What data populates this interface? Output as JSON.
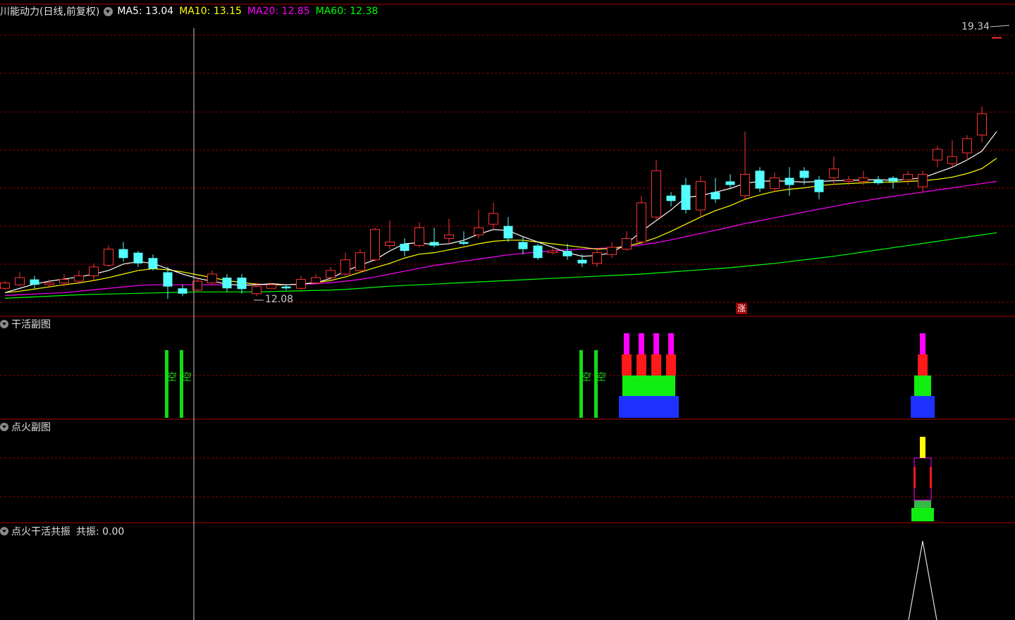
{
  "header": {
    "stock_name": "川能动力(日线,前复权)",
    "ma_labels": [
      {
        "text": "MA5: 13.04",
        "color": "#ffffff"
      },
      {
        "text": "MA10: 13.15",
        "color": "#ffff00"
      },
      {
        "text": "MA20: 12.85",
        "color": "#ff00ff"
      },
      {
        "text": "MA60: 12.38",
        "color": "#00ff00"
      }
    ]
  },
  "annotations": {
    "high_label": "19.34",
    "low_label": "12.08",
    "zhang_badge": "涨"
  },
  "panels": [
    {
      "title": "干活副图"
    },
    {
      "title": "点火副图"
    },
    {
      "title": "点火干活共振",
      "value_text": "共振: 0.00"
    }
  ],
  "colors": {
    "up": "#ff3232",
    "down": "#54ffff",
    "ma5": "#ffffff",
    "ma10": "#ffff00",
    "ma20": "#ff00ff",
    "ma60": "#00ff00",
    "grid": "#8b0000",
    "border": "#b00000"
  },
  "chart_data": [
    {
      "type": "candlestick",
      "x": [
        0,
        1,
        2,
        3,
        4,
        5,
        6,
        7,
        8,
        9,
        10,
        11,
        12,
        13,
        14,
        15,
        16,
        17,
        18,
        19,
        20,
        21,
        22,
        23,
        24,
        25,
        26,
        27,
        28,
        29,
        30,
        31,
        32,
        33,
        34,
        35,
        36,
        37,
        38,
        39,
        40,
        41,
        42,
        43,
        44,
        45,
        46,
        47,
        48,
        49,
        50,
        51,
        52,
        53,
        54,
        55,
        56,
        57,
        58,
        59,
        60,
        61,
        62,
        63,
        64,
        65,
        66,
        67
      ],
      "open": [
        12.3,
        12.4,
        12.55,
        12.4,
        12.45,
        12.5,
        12.65,
        12.95,
        13.4,
        13.3,
        13.15,
        12.75,
        12.3,
        12.25,
        12.45,
        12.6,
        12.6,
        12.15,
        12.3,
        12.35,
        12.3,
        12.45,
        12.6,
        12.7,
        12.8,
        13.1,
        13.5,
        13.55,
        13.5,
        13.6,
        13.7,
        13.6,
        13.8,
        14.1,
        14.05,
        13.6,
        13.5,
        13.3,
        13.35,
        13.1,
        13.0,
        13.25,
        13.4,
        13.6,
        14.3,
        14.9,
        15.2,
        14.5,
        15.0,
        15.3,
        14.9,
        15.6,
        15.1,
        15.4,
        15.6,
        15.35,
        15.4,
        15.3,
        15.3,
        15.35,
        15.4,
        15.35,
        15.15,
        15.9,
        15.8,
        16.1,
        16.6,
        19.34
      ],
      "close": [
        12.45,
        12.6,
        12.4,
        12.45,
        12.55,
        12.65,
        12.9,
        13.4,
        13.15,
        13.0,
        12.85,
        12.35,
        12.15,
        12.5,
        12.7,
        12.3,
        12.28,
        12.35,
        12.4,
        12.3,
        12.55,
        12.6,
        12.8,
        13.1,
        13.3,
        13.95,
        13.6,
        13.35,
        14.0,
        13.5,
        13.8,
        13.55,
        14.0,
        14.4,
        13.7,
        13.4,
        13.15,
        13.35,
        13.2,
        13.0,
        13.3,
        13.45,
        13.7,
        14.7,
        15.6,
        14.75,
        14.5,
        15.3,
        14.8,
        15.2,
        15.5,
        15.1,
        15.4,
        15.2,
        15.4,
        15.0,
        15.65,
        15.35,
        15.4,
        15.25,
        15.3,
        15.5,
        15.5,
        16.2,
        16.0,
        16.5,
        17.2,
        19.34
      ],
      "high": [
        12.5,
        12.75,
        12.65,
        12.55,
        12.7,
        12.8,
        13.0,
        13.5,
        13.6,
        13.35,
        13.25,
        12.9,
        12.4,
        12.6,
        12.8,
        12.7,
        12.7,
        12.45,
        12.45,
        12.4,
        12.65,
        12.7,
        12.9,
        13.3,
        13.4,
        14.0,
        14.2,
        13.7,
        14.15,
        14.0,
        14.25,
        13.9,
        14.5,
        14.7,
        14.3,
        13.75,
        13.55,
        13.45,
        13.55,
        13.25,
        13.4,
        13.6,
        13.9,
        14.9,
        15.9,
        15.0,
        15.4,
        15.45,
        15.4,
        15.5,
        16.7,
        15.7,
        15.55,
        15.7,
        15.7,
        15.45,
        16.0,
        15.45,
        15.6,
        15.45,
        15.45,
        15.6,
        15.6,
        16.3,
        16.45,
        16.6,
        17.4,
        19.34
      ],
      "low": [
        12.25,
        12.35,
        12.3,
        12.35,
        12.35,
        12.45,
        12.5,
        12.9,
        13.05,
        12.9,
        12.8,
        12.0,
        12.08,
        12.2,
        12.4,
        12.2,
        12.15,
        12.08,
        12.3,
        12.25,
        12.25,
        12.4,
        12.55,
        12.65,
        12.75,
        13.05,
        13.4,
        13.2,
        13.45,
        13.45,
        13.55,
        13.5,
        13.7,
        13.95,
        13.6,
        13.25,
        13.1,
        13.25,
        13.1,
        12.9,
        12.9,
        13.15,
        13.35,
        13.55,
        14.2,
        14.6,
        14.4,
        14.3,
        14.7,
        15.1,
        14.8,
        15.0,
        15.0,
        14.9,
        15.2,
        14.8,
        15.2,
        15.2,
        15.2,
        15.2,
        15.1,
        15.2,
        15.0,
        15.7,
        15.7,
        15.9,
        16.4,
        19.34
      ],
      "ma5": [
        12.18,
        12.3,
        12.42,
        12.5,
        12.56,
        12.62,
        12.7,
        12.8,
        12.98,
        13.05,
        13.0,
        12.85,
        12.7,
        12.58,
        12.5,
        12.42,
        12.38,
        12.4,
        12.43,
        12.4,
        12.42,
        12.45,
        12.58,
        12.78,
        12.95,
        13.1,
        13.35,
        13.55,
        13.58,
        13.52,
        13.55,
        13.65,
        13.82,
        13.95,
        13.92,
        13.75,
        13.6,
        13.45,
        13.3,
        13.2,
        13.22,
        13.3,
        13.55,
        13.9,
        14.2,
        14.5,
        14.85,
        14.9,
        15.0,
        15.1,
        15.25,
        15.3,
        15.32,
        15.3,
        15.28,
        15.3,
        15.32,
        15.33,
        15.34,
        15.35,
        15.33,
        15.36,
        15.4,
        15.55,
        15.7,
        15.9,
        16.15,
        16.7
      ],
      "ma10": [
        12.18,
        12.22,
        12.28,
        12.34,
        12.4,
        12.45,
        12.52,
        12.6,
        12.7,
        12.8,
        12.85,
        12.82,
        12.76,
        12.68,
        12.6,
        12.52,
        12.46,
        12.42,
        12.4,
        12.4,
        12.42,
        12.46,
        12.52,
        12.62,
        12.75,
        12.88,
        13.0,
        13.15,
        13.26,
        13.3,
        13.38,
        13.46,
        13.55,
        13.62,
        13.65,
        13.65,
        13.6,
        13.55,
        13.5,
        13.45,
        13.4,
        13.42,
        13.48,
        13.58,
        13.72,
        13.9,
        14.1,
        14.3,
        14.48,
        14.62,
        14.8,
        14.92,
        15.02,
        15.08,
        15.12,
        15.18,
        15.22,
        15.24,
        15.26,
        15.28,
        15.28,
        15.3,
        15.32,
        15.36,
        15.42,
        15.52,
        15.66,
        15.95
      ],
      "ma20": [
        12.1,
        12.12,
        12.14,
        12.16,
        12.18,
        12.22,
        12.26,
        12.3,
        12.34,
        12.38,
        12.4,
        12.4,
        12.4,
        12.4,
        12.4,
        12.4,
        12.4,
        12.4,
        12.4,
        12.4,
        12.41,
        12.43,
        12.46,
        12.5,
        12.55,
        12.62,
        12.7,
        12.78,
        12.86,
        12.94,
        13.0,
        13.06,
        13.12,
        13.18,
        13.24,
        13.28,
        13.32,
        13.35,
        13.38,
        13.4,
        13.42,
        13.44,
        13.47,
        13.52,
        13.58,
        13.66,
        13.75,
        13.84,
        13.93,
        14.02,
        14.12,
        14.2,
        14.28,
        14.36,
        14.44,
        14.52,
        14.6,
        14.68,
        14.75,
        14.82,
        14.88,
        14.94,
        15.0,
        15.06,
        15.12,
        15.18,
        15.24,
        15.3
      ],
      "ma60": [
        12.02,
        12.04,
        12.06,
        12.08,
        12.1,
        12.12,
        12.13,
        12.14,
        12.15,
        12.16,
        12.17,
        12.18,
        12.19,
        12.2,
        12.2,
        12.2,
        12.2,
        12.2,
        12.21,
        12.22,
        12.23,
        12.24,
        12.25,
        12.27,
        12.3,
        12.33,
        12.36,
        12.38,
        12.4,
        12.42,
        12.44,
        12.46,
        12.48,
        12.5,
        12.52,
        12.54,
        12.56,
        12.58,
        12.6,
        12.62,
        12.64,
        12.66,
        12.68,
        12.7,
        12.73,
        12.76,
        12.79,
        12.82,
        12.85,
        12.88,
        12.92,
        12.96,
        13.0,
        13.05,
        13.1,
        13.15,
        13.2,
        13.26,
        13.32,
        13.38,
        13.44,
        13.5,
        13.56,
        13.62,
        13.68,
        13.74,
        13.8,
        13.86
      ],
      "ylim": [
        11.85,
        19.6
      ]
    },
    {
      "type": "bar",
      "title": "干活副图",
      "green_lines": [
        11,
        12,
        39,
        40
      ],
      "green_line_labels": [
        "空",
        "空",
        "空",
        "空"
      ],
      "stacks": [
        {
          "x": [
            42,
            43,
            44,
            45
          ],
          "blue": 0.25,
          "green": 0.25,
          "red": 0.25,
          "magenta": 0.25
        },
        {
          "x": [
            62
          ],
          "blue": 0.25,
          "green": 0.25,
          "red": 0.25,
          "magenta": 0.25
        }
      ]
    },
    {
      "type": "bar",
      "title": "点火副图",
      "stacks": [
        {
          "x": [
            62
          ],
          "green": 0.25,
          "red_outline": 0.5,
          "yellow": 0.25
        }
      ]
    },
    {
      "type": "line",
      "title": "点火干活共振",
      "value": 0.0,
      "spike_at": 62
    }
  ]
}
